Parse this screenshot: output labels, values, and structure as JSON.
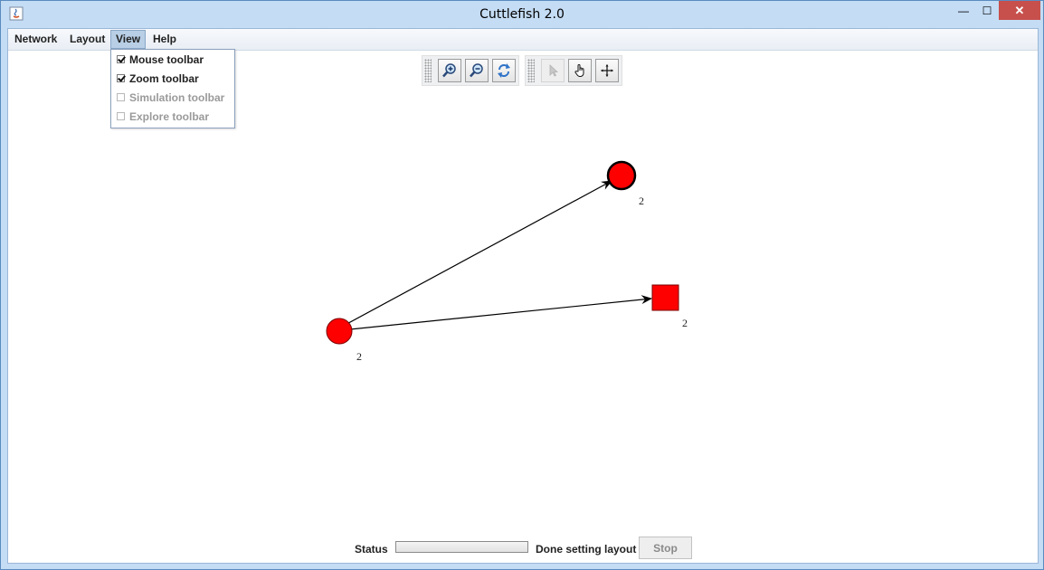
{
  "window": {
    "title": "Cuttlefish 2.0",
    "close_glyph": "✕",
    "min_glyph": "—",
    "max_glyph": "☐"
  },
  "menubar": {
    "items": [
      {
        "label": "Network"
      },
      {
        "label": "Layout"
      },
      {
        "label": "View"
      },
      {
        "label": "Help"
      }
    ],
    "active": "View"
  },
  "view_menu": {
    "items": [
      {
        "label": "Mouse toolbar",
        "checked": true,
        "enabled": true
      },
      {
        "label": "Zoom toolbar",
        "checked": true,
        "enabled": true
      },
      {
        "label": "Simulation toolbar",
        "checked": false,
        "enabled": false
      },
      {
        "label": "Explore toolbar",
        "checked": false,
        "enabled": false
      }
    ]
  },
  "zoom_toolbar": {
    "buttons": [
      {
        "icon": "zoom-in-icon"
      },
      {
        "icon": "zoom-out-icon"
      },
      {
        "icon": "refresh-icon"
      }
    ]
  },
  "mouse_toolbar": {
    "buttons": [
      {
        "icon": "pointer-icon",
        "enabled": false
      },
      {
        "icon": "hand-icon",
        "enabled": true
      },
      {
        "icon": "move-icon",
        "enabled": true
      }
    ]
  },
  "graph": {
    "node_color": "#ff0000",
    "nodes": [
      {
        "id": "source",
        "shape": "circle",
        "label": "2"
      },
      {
        "id": "target-circle",
        "shape": "circle",
        "label": "2",
        "selected": true
      },
      {
        "id": "target-square",
        "shape": "square",
        "label": "2"
      }
    ],
    "edges": [
      {
        "from": "source",
        "to": "target-circle",
        "directed": true
      },
      {
        "from": "source",
        "to": "target-square",
        "directed": true
      }
    ]
  },
  "status": {
    "label": "Status",
    "message": "Done setting layout",
    "progress": 0,
    "stop_label": "Stop"
  }
}
